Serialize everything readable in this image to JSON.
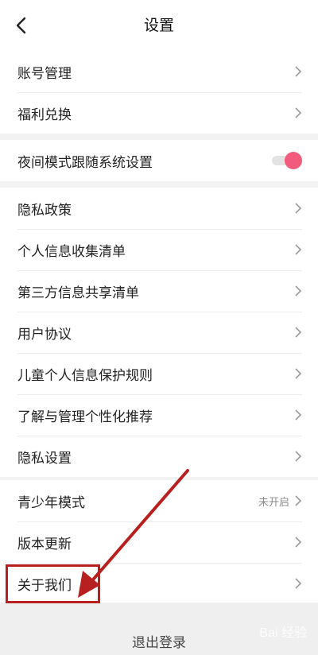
{
  "header": {
    "title": "设置",
    "back_icon": "chevron-left-icon"
  },
  "groups": [
    {
      "items": [
        {
          "label": "账号管理"
        },
        {
          "label": "福利兑换"
        }
      ]
    },
    {
      "items": [
        {
          "label": "夜间模式跟随系统设置",
          "toggle_on": true
        }
      ]
    },
    {
      "items": [
        {
          "label": "隐私政策"
        },
        {
          "label": "个人信息收集清单"
        },
        {
          "label": "第三方信息共享清单"
        },
        {
          "label": "用户协议"
        },
        {
          "label": "儿童个人信息保护规则"
        },
        {
          "label": "了解与管理个性化推荐"
        },
        {
          "label": "隐私设置"
        }
      ]
    },
    {
      "items": [
        {
          "label": "青少年模式",
          "status": "未开启"
        },
        {
          "label": "版本更新"
        },
        {
          "label": "关于我们"
        }
      ]
    }
  ],
  "logout_label": "退出登录",
  "annotation": {
    "color": "#b81f1f"
  },
  "watermark": "Bai 经验",
  "colors": {
    "toggle_accent": "#f25b7b",
    "background": "#f2f2f2"
  }
}
